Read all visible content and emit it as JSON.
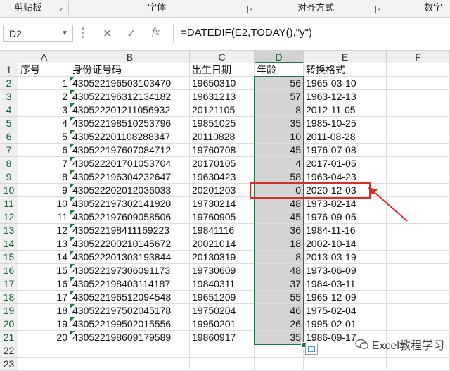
{
  "ribbon": {
    "groups": [
      "剪贴板",
      "字体",
      "对齐方式",
      "数字"
    ]
  },
  "formula_bar": {
    "name_box": "D2",
    "fx_label": "fx",
    "formula": "=DATEDIF(E2,TODAY(),\"y\")"
  },
  "columns": [
    "A",
    "B",
    "C",
    "D",
    "E",
    "F"
  ],
  "header_row": {
    "a": "序号",
    "b": "身份证号码",
    "c": "出生日期",
    "d": "年龄",
    "e": "转换格式"
  },
  "rows": [
    {
      "n": "2",
      "a": "1",
      "b": "430522196503103470",
      "c": "19650310",
      "d": "56",
      "e": "1965-03-10"
    },
    {
      "n": "3",
      "a": "2",
      "b": "430522196312134182",
      "c": "19631213",
      "d": "57",
      "e": "1963-12-13"
    },
    {
      "n": "4",
      "a": "3",
      "b": "430522201211056932",
      "c": "20121105",
      "d": "8",
      "e": "2012-11-05"
    },
    {
      "n": "5",
      "a": "4",
      "b": "430522198510253796",
      "c": "19851025",
      "d": "35",
      "e": "1985-10-25"
    },
    {
      "n": "6",
      "a": "5",
      "b": "430522201108288347",
      "c": "20110828",
      "d": "10",
      "e": "2011-08-28"
    },
    {
      "n": "7",
      "a": "6",
      "b": "430522197607084712",
      "c": "19760708",
      "d": "45",
      "e": "1976-07-08"
    },
    {
      "n": "8",
      "a": "7",
      "b": "430522201701053704",
      "c": "20170105",
      "d": "4",
      "e": "2017-01-05"
    },
    {
      "n": "9",
      "a": "8",
      "b": "430522196304232647",
      "c": "19630423",
      "d": "58",
      "e": "1963-04-23"
    },
    {
      "n": "10",
      "a": "9",
      "b": "430522202012036033",
      "c": "20201203",
      "d": "0",
      "e": "2020-12-03"
    },
    {
      "n": "11",
      "a": "10",
      "b": "430522197302141920",
      "c": "19730214",
      "d": "48",
      "e": "1973-02-14"
    },
    {
      "n": "12",
      "a": "11",
      "b": "430522197609058506",
      "c": "19760905",
      "d": "45",
      "e": "1976-09-05"
    },
    {
      "n": "13",
      "a": "12",
      "b": "430522198411169223",
      "c": "19841116",
      "d": "36",
      "e": "1984-11-16"
    },
    {
      "n": "14",
      "a": "13",
      "b": "430522200210145672",
      "c": "20021014",
      "d": "18",
      "e": "2002-10-14"
    },
    {
      "n": "15",
      "a": "14",
      "b": "430522201303193844",
      "c": "20130319",
      "d": "8",
      "e": "2013-03-19"
    },
    {
      "n": "16",
      "a": "15",
      "b": "430522197306091173",
      "c": "19730609",
      "d": "48",
      "e": "1973-06-09"
    },
    {
      "n": "17",
      "a": "16",
      "b": "430522198403114187",
      "c": "19840311",
      "d": "37",
      "e": "1984-03-11"
    },
    {
      "n": "18",
      "a": "17",
      "b": "430522196512094548",
      "c": "19651209",
      "d": "55",
      "e": "1965-12-09"
    },
    {
      "n": "19",
      "a": "18",
      "b": "430522197502045178",
      "c": "19750204",
      "d": "46",
      "e": "1975-02-04"
    },
    {
      "n": "20",
      "a": "19",
      "b": "430522199502015556",
      "c": "19950201",
      "d": "26",
      "e": "1995-02-01"
    },
    {
      "n": "21",
      "a": "20",
      "b": "430522198609179589",
      "c": "19860917",
      "d": "35",
      "e": "1986-09-17"
    }
  ],
  "extra_rows": [
    "22",
    "23"
  ],
  "watermark": "Excel教程学习",
  "colors": {
    "selection": "#217346",
    "highlight_box": "#d0312d",
    "selected_fill": "#d4d4d4"
  }
}
